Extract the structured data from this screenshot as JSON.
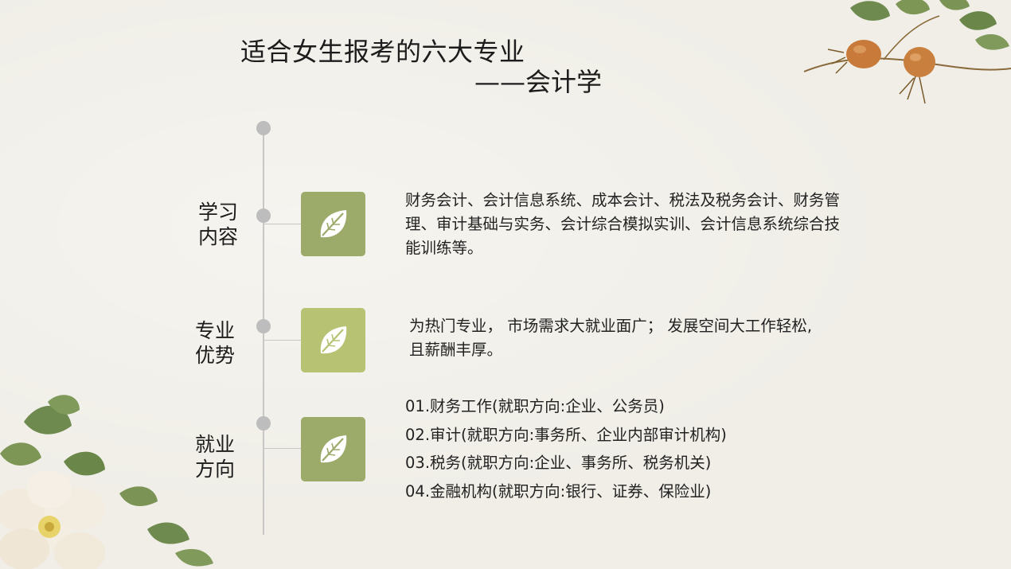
{
  "title": {
    "line1": "适合女生报考的六大专业",
    "line2": "——会计学"
  },
  "colors": {
    "box_dark": "#9caa6a",
    "box_light": "#b7c273",
    "timeline": "#c7c7c7",
    "dot": "#bdbdbd"
  },
  "sections": {
    "study": {
      "label_line1": "学习",
      "label_line2": "内容",
      "icon": "leaf-icon",
      "text": "财务会计、会计信息系统、成本会计、税法及税务会计、财务管理、审计基础与实务、会计综合模拟实训、会计信息系统综合技能训练等。"
    },
    "advantage": {
      "label_line1": "专业",
      "label_line2": "优势",
      "icon": "leaf-icon",
      "text": "为热门专业， 市场需求大就业面广； 发展空间大工作轻松,且薪酬丰厚。"
    },
    "career": {
      "label_line1": "就业",
      "label_line2": "方向",
      "icon": "leaf-icon",
      "items": [
        "01.财务工作(就职方向:企业、公务员)",
        "02.审计(就职方向:事务所、企业内部审计机构)",
        "03.税务(就职方向:企业、事务所、税务机关)",
        "04.金融机构(就职方向:银行、证券、保险业)"
      ]
    }
  }
}
